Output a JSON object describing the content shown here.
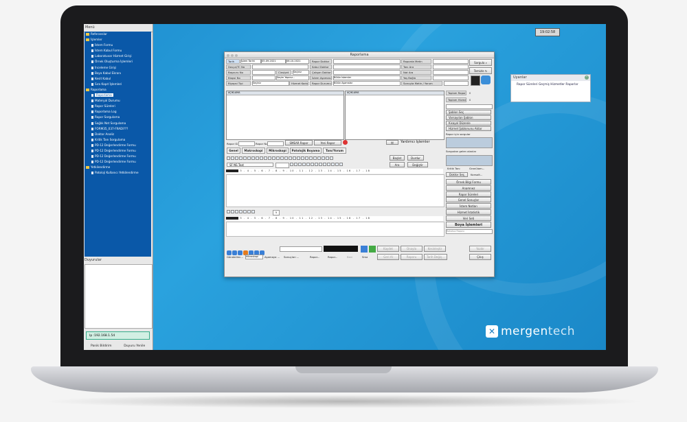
{
  "clock": "19:02:58",
  "menu": {
    "title": "Menü",
    "items": [
      {
        "label": "Referanslar",
        "level": 0,
        "icon": "folder-icon"
      },
      {
        "label": "İşlemler",
        "level": 0,
        "icon": "folder-icon"
      },
      {
        "label": "İstem Formu",
        "level": 1,
        "icon": "doc-icon"
      },
      {
        "label": "İstem Kabul Formu",
        "level": 1,
        "icon": "doc-icon"
      },
      {
        "label": "Laboratuvar Hizmet Girişi",
        "level": 1,
        "icon": "doc-icon"
      },
      {
        "label": "Örnek Oluşturma İşlemleri",
        "level": 1,
        "icon": "doc-icon"
      },
      {
        "label": "İnceleme Girişi",
        "level": 1,
        "icon": "doc-icon"
      },
      {
        "label": "Boya Kabul Ekranı",
        "level": 1,
        "icon": "doc-icon"
      },
      {
        "label": "Kesit Kabul",
        "level": 1,
        "icon": "doc-icon"
      },
      {
        "label": "Sıra Kapıt İşlemleri",
        "level": 1,
        "icon": "doc-icon"
      },
      {
        "label": "Raporlama",
        "level": 0,
        "icon": "folder-icon"
      },
      {
        "label": "Raporlama",
        "level": 1,
        "icon": "doc-icon",
        "selected": true
      },
      {
        "label": "Materyal Durumu",
        "level": 1,
        "icon": "doc-icon"
      },
      {
        "label": "Rapor Süreleri",
        "level": 1,
        "icon": "doc-icon"
      },
      {
        "label": "Raporlama Log",
        "level": 1,
        "icon": "doc-icon"
      },
      {
        "label": "Rapor Sorgulama",
        "level": 1,
        "icon": "doc-icon"
      },
      {
        "label": "Sağlık Net Sorgulama",
        "level": 1,
        "icon": "doc-icon"
      },
      {
        "label": "FORM35_037-FRADI???",
        "level": 1,
        "icon": "doc-icon"
      },
      {
        "label": "Doktor Analiz",
        "level": 1,
        "icon": "doc-icon"
      },
      {
        "label": "Kritik Tanı Sorgulama",
        "level": 1,
        "icon": "doc-icon"
      },
      {
        "label": "PD-12 Değerlendirme Formu",
        "level": 1,
        "icon": "doc-icon"
      },
      {
        "label": "PD-12 Değerlendirme Formu",
        "level": 1,
        "icon": "doc-icon"
      },
      {
        "label": "PD-12 Değerlendirme Formu",
        "level": 1,
        "icon": "doc-icon"
      },
      {
        "label": "PD-12 Değerlendirme Formu",
        "level": 1,
        "icon": "doc-icon"
      },
      {
        "label": "Yetkilendirme",
        "level": 0,
        "icon": "folder-icon"
      },
      {
        "label": "Patoloji Kullanıcı Yetkilendirme",
        "level": 1,
        "icon": "doc-icon"
      }
    ],
    "duyurular_title": "Duyurular",
    "ip": "Ip :192.168.1.54",
    "panik_bildirim": "Panik Bildirim",
    "duyuru_yenile": "Duyuru Yenile"
  },
  "uyarilar": {
    "title": "Uyarılar",
    "text": "Rapor Süreleri Geçmiş Hizmetler Raporlar"
  },
  "logo": {
    "part1": "mergen",
    "part2": "tech"
  },
  "window": {
    "title": "Raporlama",
    "filters": {
      "tarih": "Tarih",
      "islem_tarihi": "İşlem Tarihi",
      "date_from": "05.09.2021",
      "date_to": "06.10.2021",
      "dosya_no": "Dosya/TC No",
      "basvuru_no": "Başvuru No",
      "cinsiyet": "Cinsiyet",
      "seciniz": "Seçiniz",
      "biopsi_no": "Biopsi No",
      "secim_yapiniz": "Seçim Yapınız...",
      "biyopsi_tipi": "Biyopsi Tipi",
      "hizmet_kodu": "Hizmet Kodu",
      "rapor_doktor": "Rapor Doktor",
      "kabul_doktor": "Kabul Doktor",
      "calisan_doktor": "Çalışan Doktor",
      "istem_asamasi": "İstem Aşaması",
      "rapor_durumu": "Rapor Durumu",
      "butun_istemler": "Bütün İstemler",
      "butun_asamalar": "Bütün Aşamalar",
      "raporda_metin": "Raporda Metin",
      "tani_ara": "Tanı Ara",
      "not_ara": "Not Ara",
      "yas_baglа": "Yaş Bağla",
      "sonucta_metin": "Sonuçta Metin / Yorum",
      "sorgula": "Sorgula",
      "temizle": "Temizle"
    },
    "panes": {
      "left_header": "AÇIKLAMA",
      "right_header": "AÇIKLAMA"
    },
    "stats": {
      "toplam_rapor": "Toplam Rapor",
      "toplam_rapor_val": "0",
      "toplam_hizmet": "Toplam Hizmet",
      "toplam_hizmet_val": "0"
    },
    "right_buttons": [
      "Şablon Seç",
      "Varsayılan Şablon",
      "Kısayol Düzenle",
      "Hizmet Şablonunu Aktar"
    ],
    "rapor_icin_sorgular": "Rapor için sorgular",
    "sorgudan_gelen": "Sorgudan gelen alanlar",
    "kritik_tani": "Kritik Tanı",
    "granulom": "Granülom...",
    "doktor_sec": "Doktor Seç",
    "konsolt": "Konsolt...",
    "action_buttons": [
      "Örnek Bilgi Formu",
      "Anamnez",
      "Rapor Süreleri",
      "Genel Sonuçlar",
      "İstem Notları",
      "Hizmet İstatistik",
      "Veri Seti"
    ],
    "boya_islemleri": "Boya İşlemleri",
    "rapor_select": "Rahatsız Raporu",
    "rapor_id": "Rapor ID",
    "rapor_no": "Rapor No",
    "smear_rapor": "SMEAR Rapor",
    "yeni_rapor": "Yeni Rapor",
    "yardimci": "Yardımcı İşlemler",
    "tabs": [
      "Genel",
      "Makroskopi",
      "Mikroskopi",
      "Patolojik Boyama",
      "Tanı/Yorum"
    ],
    "font_name": "SF NS Text",
    "baslat": "Başlat",
    "durdur": "Durdur",
    "ara": "Ara",
    "degistir": "Değiştir",
    "ruler_nums": "3 . 4 . 5 . 6 . 7 . 8 . 9 . 10 . 11 . 12 . 13 . 14 . 15 . 16 . 17 . 18",
    "ruler_nums2": "3 . 4 . 5 . 6 . 7 . 8 . 9 . 10 . 11 . 12 . 13 . 14 . 15 . 16 . 17 . 18",
    "size_val": "5",
    "bottom": {
      "kaydet": "Kaydet",
      "onayla": "Onayla",
      "kesinlestir": "Kesinleştir",
      "yazdir": "Yazdır",
      "geri_al": "Geri Al",
      "raporu": "Raporu",
      "tarih_degis": "Tarih Değiş...",
      "cikis": "Çıkış",
      "gonderilec": "Gönderilec...",
      "mikroskopi": "Mikroskopi",
      "asamaya": "Aşamaya ...",
      "sonuclari": "Sonuçları ...",
      "rapor1": "Rapor...",
      "rapor2": "Rapor...",
      "beni": "Beni",
      "sma": "Sma"
    }
  }
}
